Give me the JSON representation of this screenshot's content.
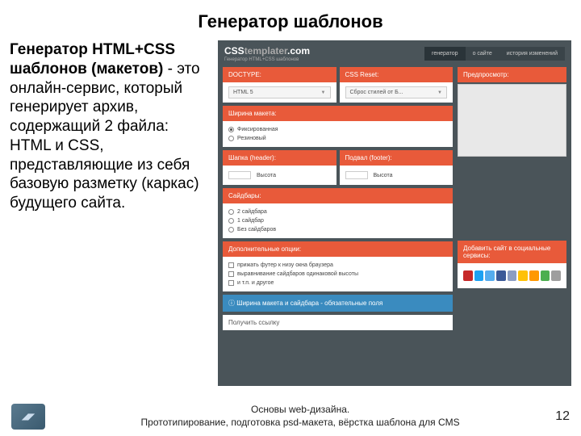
{
  "slide": {
    "title": "Генератор шаблонов",
    "body_bold": "Генератор HTML+CSS шаблонов (макетов)",
    "body_rest": " - это онлайн-сервис, который генерирует архив, содержащий 2 файла: HTML и CSS, представляющие из себя базовую разметку (каркас) будущего сайта."
  },
  "app": {
    "logo1": "CSS",
    "logo2": "templater",
    "logo3": ".com",
    "tagline": "Генератор HTML+CSS шаблонов",
    "nav": [
      "генератор",
      "о сайте",
      "история изменений"
    ],
    "panels": {
      "doctype": "DOCTYPE:",
      "doctype_val": "HTML 5",
      "reset": "CSS Reset:",
      "reset_val": "Сброс стилей от Б...",
      "width": "Ширина макета:",
      "width_opts": [
        "Фиксированная",
        "Резиновый"
      ],
      "header": "Шапка (header):",
      "footer_h": "Подвал (footer):",
      "height_label": "Высота",
      "sidebars": "Сайдбары:",
      "sidebar_opts": [
        "2 сайдбара",
        "1 сайдбар",
        "Без сайдбаров"
      ],
      "extra": "Дополнительные опции:",
      "extra_opts": [
        "прижать футер к низу окна браузера",
        "выравнивание сайдбаров одинаковой высоты",
        "и т.п. и другое"
      ],
      "note": "Ширина макета и сайдбара - обязательные поля",
      "link_btn": "Получить ссылку",
      "preview_h": "Предпросмотр:",
      "social_h": "Добавить сайт в социальные сервисы:"
    }
  },
  "footer": {
    "line1": "Основы web-дизайна.",
    "line2": "Прототипирование, подготовка psd-макета, вёрстка шаблона для CMS",
    "page": "12"
  },
  "colors": {
    "social": [
      "#c62828",
      "#1da1f2",
      "#55acee",
      "#3b5998",
      "#8b9dc3",
      "#ffc107",
      "#ff9800",
      "#4caf50",
      "#9e9e9e"
    ]
  }
}
